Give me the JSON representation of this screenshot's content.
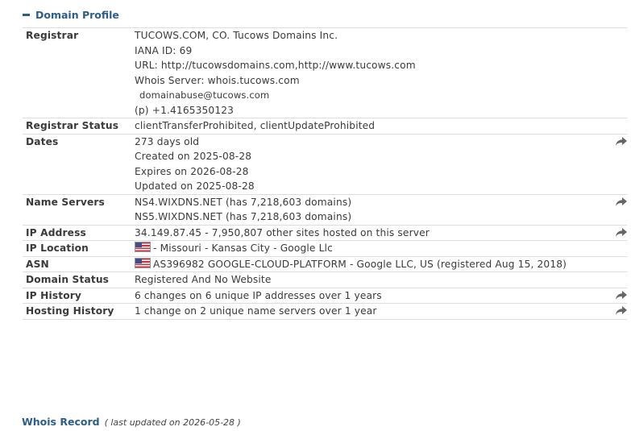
{
  "header": {
    "title": "Domain Profile"
  },
  "rows": {
    "registrar": {
      "label": "Registrar",
      "lines": [
        "TUCOWS.COM, CO. Tucows Domains Inc.",
        "IANA ID: 69",
        "URL: http://tucowsdomains.com,http://www.tucows.com",
        "Whois Server: whois.tucows.com",
        "domainabuse@tucows.com",
        "(p)  +1.4165350123"
      ]
    },
    "registrar_status": {
      "label": "Registrar Status",
      "value": "clientTransferProhibited, clientUpdateProhibited"
    },
    "dates": {
      "label": "Dates",
      "lines": [
        "273 days old",
        "Created on 2025-08-28",
        "Expires on 2026-08-28",
        "Updated on 2025-08-28"
      ]
    },
    "name_servers": {
      "label": "Name Servers",
      "lines": [
        "NS4.WIXDNS.NET (has 7,218,603 domains)",
        "NS5.WIXDNS.NET (has 7,218,603 domains)"
      ]
    },
    "ip_address": {
      "label": "IP Address",
      "value": "34.149.87.45 - 7,950,807 other sites hosted on this server"
    },
    "ip_location": {
      "label": "IP Location",
      "value": "- Missouri - Kansas City - Google Llc"
    },
    "asn": {
      "label": "ASN",
      "value": "AS396982 GOOGLE-CLOUD-PLATFORM - Google LLC, US (registered Aug 15, 2018)"
    },
    "domain_status": {
      "label": "Domain Status",
      "value": "Registered And No Website"
    },
    "ip_history": {
      "label": "IP History",
      "value": "6 changes on 6 unique IP addresses over 1 years"
    },
    "hosting_history": {
      "label": "Hosting History",
      "value": "1 change on 2 unique name servers over 1 year"
    }
  },
  "footer": {
    "title": "Whois Record",
    "subtitle": "( last updated on 2026-05-28 )"
  },
  "icons": {
    "collapse": "minus-icon",
    "share": "share-arrow-icon",
    "flag": "us-flag-icon"
  },
  "colors": {
    "link": "#2b5e8c",
    "border": "#dddddd",
    "text": "#3a3a3a",
    "share_icon": "#666666"
  }
}
